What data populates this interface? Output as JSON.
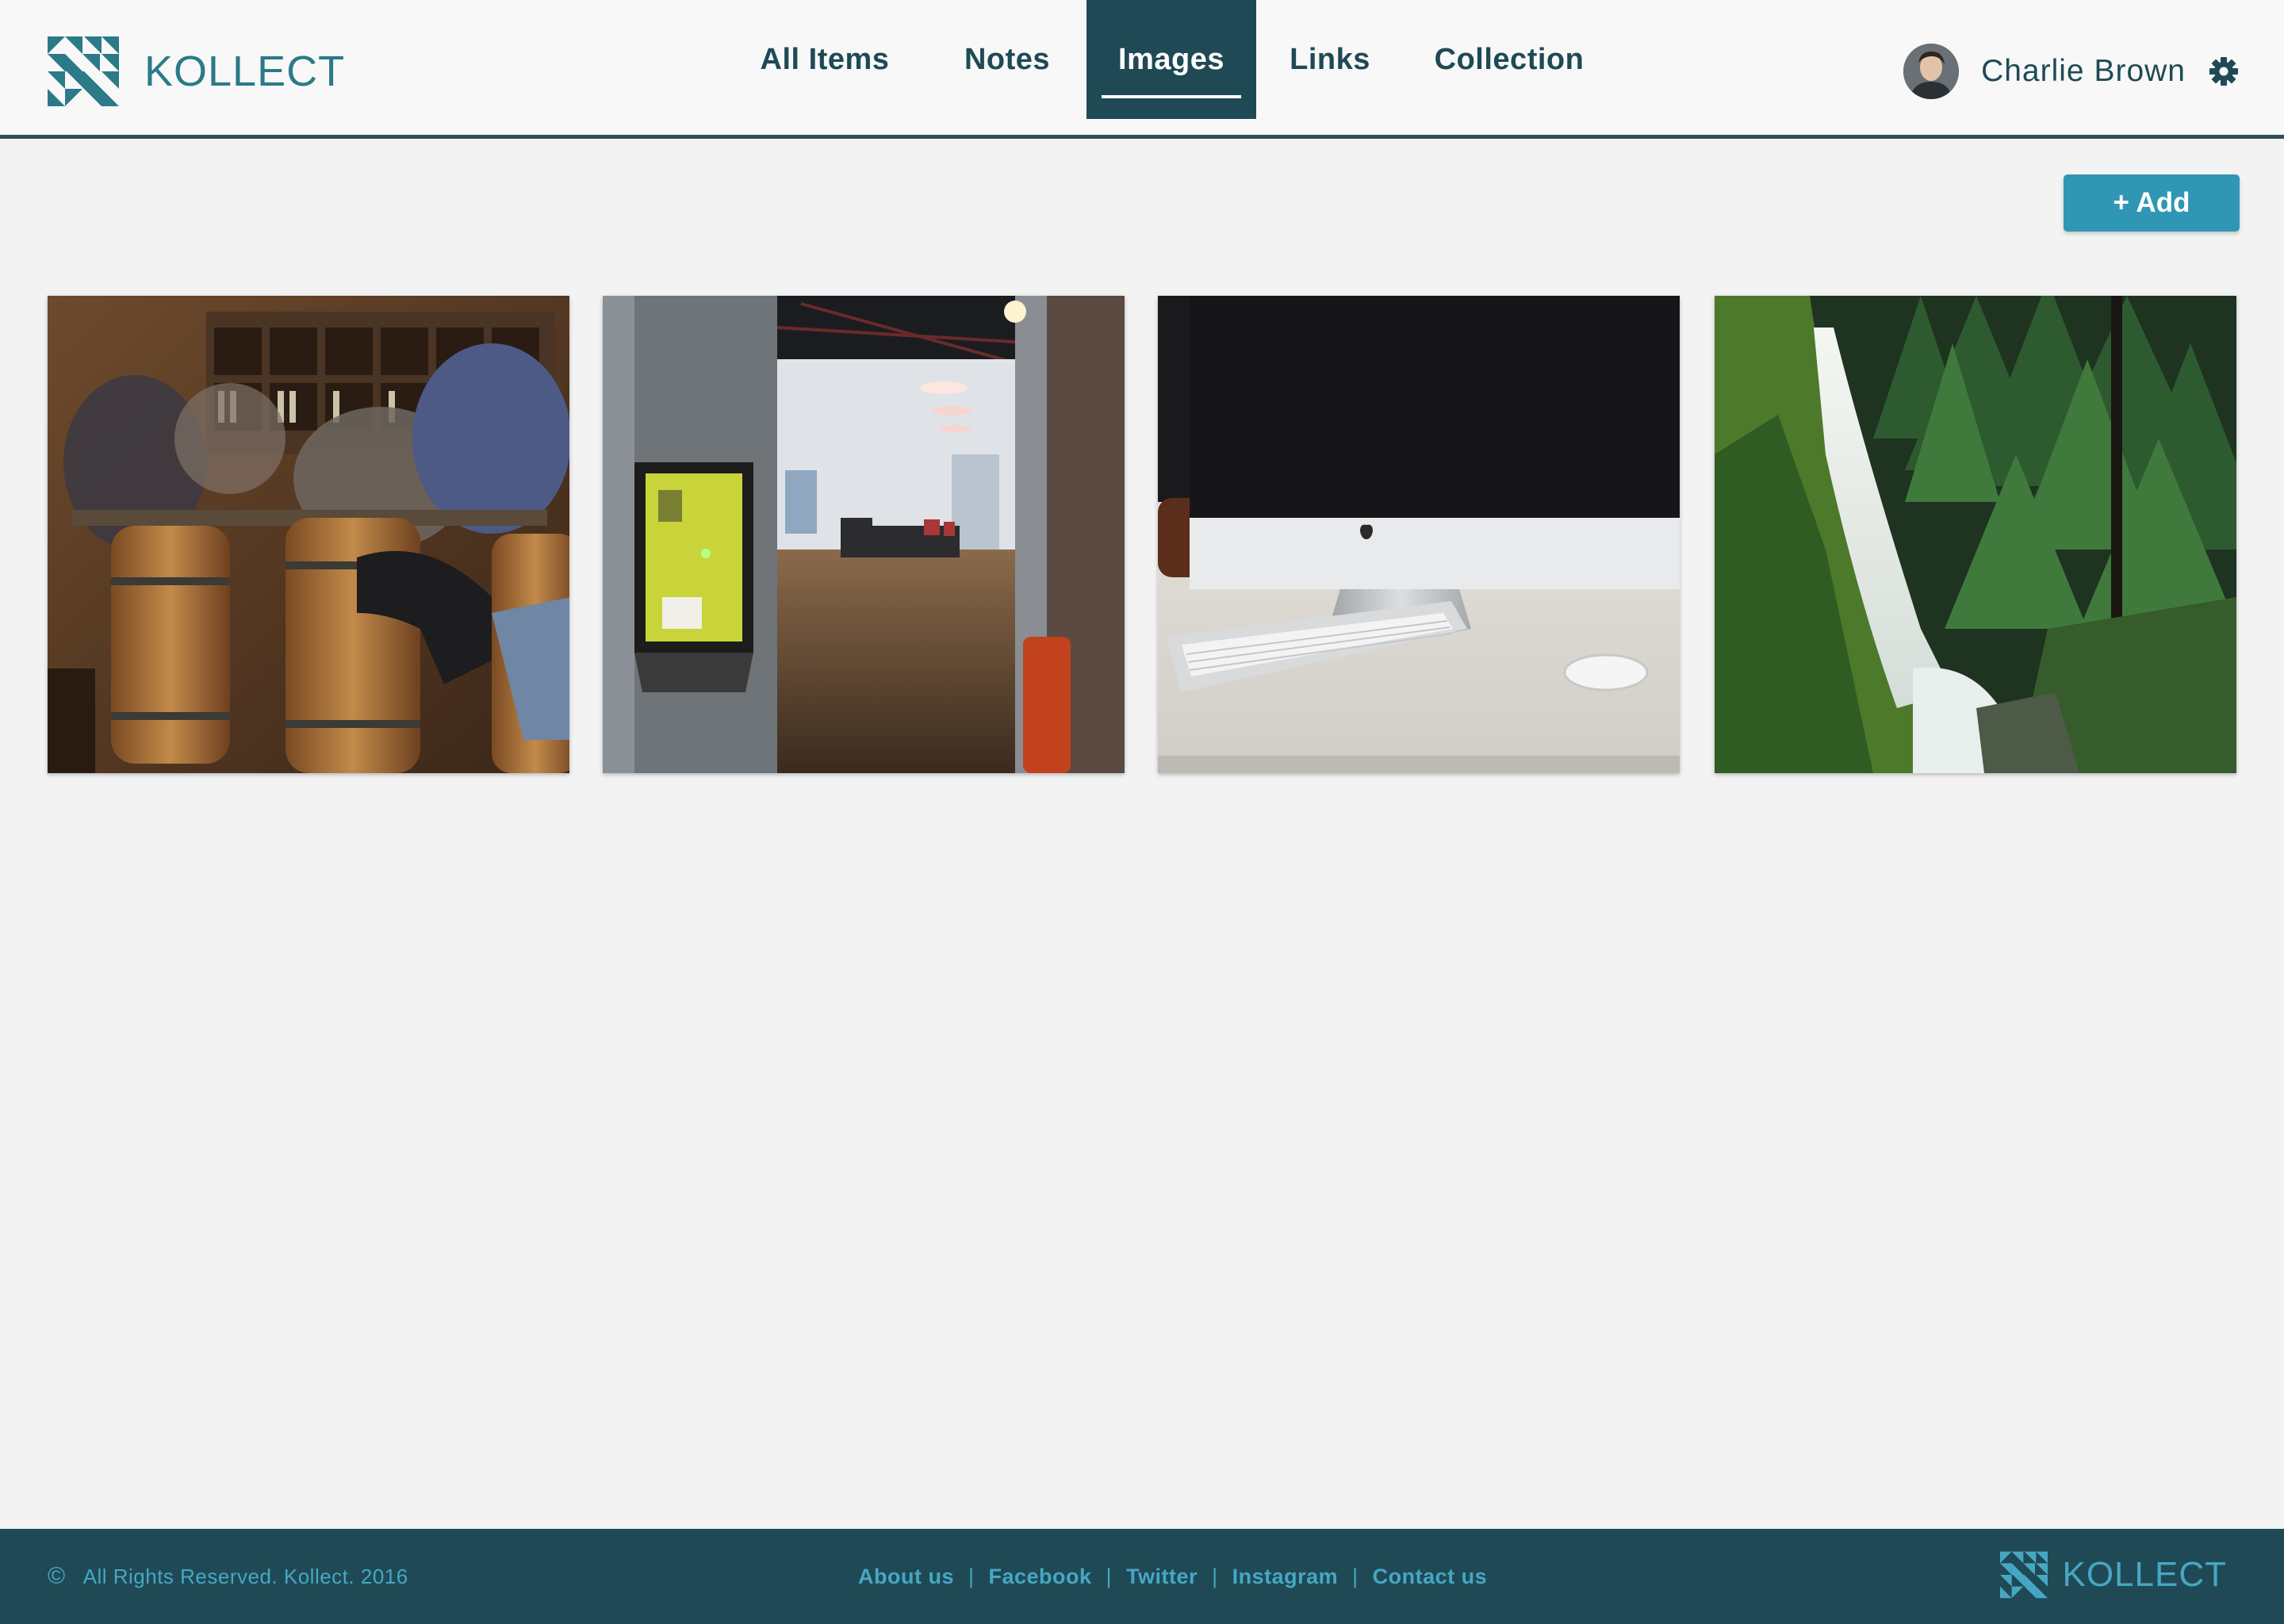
{
  "brand": {
    "name": "KOLLECT",
    "logo_icon": "triangle-grid-logo"
  },
  "nav": {
    "items": [
      {
        "label": "All Items",
        "active": false
      },
      {
        "label": "Notes",
        "active": false
      },
      {
        "label": "Images",
        "active": true
      },
      {
        "label": "Links",
        "active": false
      },
      {
        "label": "Collection",
        "active": false
      }
    ]
  },
  "user": {
    "name": "Charlie Brown",
    "settings_icon": "gear-icon"
  },
  "toolbar": {
    "add_label": "+ Add"
  },
  "images": [
    {
      "subject": "wine-bar-barrels"
    },
    {
      "subject": "office-hallway"
    },
    {
      "subject": "desktop-computer-keyboard"
    },
    {
      "subject": "forest-waterfall"
    }
  ],
  "footer": {
    "copyright_symbol": "©",
    "copyright_text": "All Rights Reserved.  Kollect. 2016",
    "links": [
      "About us",
      "Facebook",
      "Twitter",
      "Instagram",
      "Contact us"
    ],
    "brand": "KOLLECT"
  },
  "colors": {
    "primary_dark": "#1f4a55",
    "accent": "#2f97b4",
    "brand_teal": "#2b7a88",
    "footer_link": "#46a7c4",
    "background": "#f3f3f3"
  }
}
